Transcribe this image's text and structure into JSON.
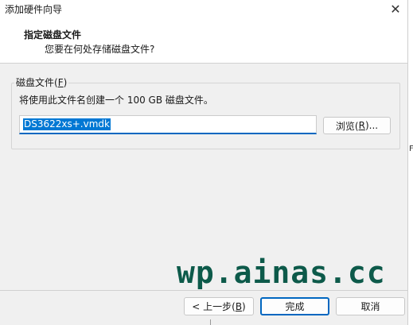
{
  "window": {
    "title": "添加硬件向导",
    "close_glyph": "✕"
  },
  "header": {
    "title": "指定磁盘文件",
    "subtitle": "您要在何处存储磁盘文件?"
  },
  "disk_file_group": {
    "label_prefix": "磁盘文件(",
    "label_accel": "F",
    "label_suffix": ")",
    "description": "将使用此文件名创建一个 100 GB 磁盘文件。",
    "file_value": "DS3622xs+.vmdk",
    "browse_prefix": "浏览(",
    "browse_accel": "R",
    "browse_suffix": ")..."
  },
  "watermark": "wp.ainas.cc",
  "footer": {
    "back_prefix": "< 上一步(",
    "back_accel": "B",
    "back_suffix": ")",
    "finish_label": "完成",
    "cancel_label": "取消"
  },
  "edge_mark": "F",
  "colors": {
    "accent": "#0067c0",
    "selection": "#0078d4",
    "watermark": "#0d5a4a",
    "window_bg": "#f0f0f0"
  }
}
